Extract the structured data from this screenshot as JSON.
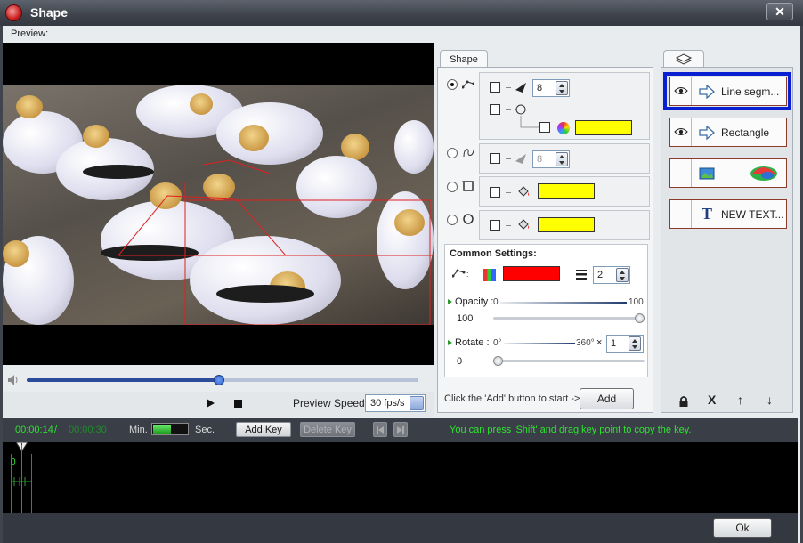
{
  "window": {
    "title": "Shape",
    "close_glyph": "✕"
  },
  "preview": {
    "label": "Preview:"
  },
  "playback": {
    "speed_label": "Preview Speed:",
    "speed_value": "30 fps/s",
    "progress": 0.49
  },
  "shape_panel": {
    "tab_label": "Shape",
    "line_arrow_size": "8",
    "curve_arrow_size": "8",
    "common_settings_label": "Common Settings:",
    "line_width": "2",
    "opacity": {
      "label": "Opacity :",
      "min": "0",
      "max": "100",
      "value": "100"
    },
    "rotate": {
      "label": "Rotate :",
      "min": "0°",
      "max": "360°",
      "times_sign": "×",
      "multiplier": "1",
      "value": "0"
    },
    "add_hint": "Click the 'Add' button to start ->",
    "add_button": "Add",
    "colors": {
      "fill": "#ffff00",
      "line": "#ff0000"
    }
  },
  "objects": [
    {
      "label": "Line segm..."
    },
    {
      "label": "Rectangle"
    },
    {
      "label": ""
    },
    {
      "label": "NEW TEXT..."
    }
  ],
  "object_controls": [
    "lock",
    "X",
    "↑",
    "↓"
  ],
  "timeline": {
    "current_time": "00:00:14",
    "separator": "/",
    "total_time": "00:00:30",
    "min_label": "Min.",
    "sec_label": "Sec.",
    "add_key": "Add Key",
    "delete_key": "Delete Key",
    "hint": "You can press 'Shift' and drag key point to copy the key.",
    "track_start": "0"
  },
  "footer": {
    "ok": "Ok"
  }
}
